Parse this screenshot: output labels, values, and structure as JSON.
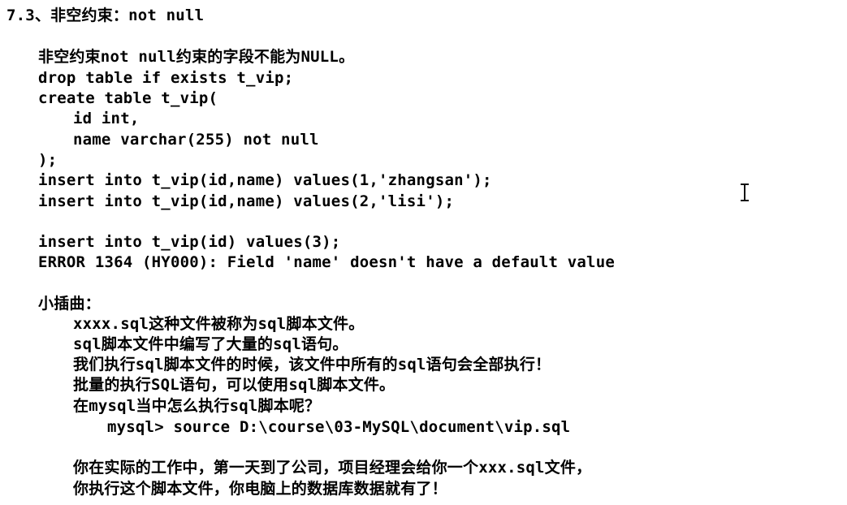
{
  "heading": "7.3、非空约束：not null",
  "lines": {
    "intro": "非空约束not null约束的字段不能为NULL。",
    "drop": "drop table if exists t_vip;",
    "create": "create table t_vip(",
    "col_id": "id int,",
    "col_name": "name varchar(255) not null",
    "close": ");",
    "insert1": "insert into t_vip(id,name) values(1,'zhangsan');",
    "insert2": "insert into t_vip(id,name) values(2,'lisi');",
    "insert3": "insert into t_vip(id) values(3);",
    "error": "ERROR 1364 (HY000): Field 'name' doesn't have a default value",
    "aside_title": "小插曲：",
    "aside1": "xxxx.sql这种文件被称为sql脚本文件。",
    "aside2": "sql脚本文件中编写了大量的sql语句。",
    "aside3": "我们执行sql脚本文件的时候，该文件中所有的sql语句会全部执行！",
    "aside4": "批量的执行SQL语句，可以使用sql脚本文件。",
    "aside5": "在mysql当中怎么执行sql脚本呢？",
    "command": "mysql> source D:\\course\\03-MySQL\\document\\vip.sql",
    "work1": "你在实际的工作中，第一天到了公司，项目经理会给你一个xxx.sql文件，",
    "work2": "你执行这个脚本文件，你电脑上的数据库数据就有了！"
  },
  "cursor_icon": "text-cursor-icon"
}
